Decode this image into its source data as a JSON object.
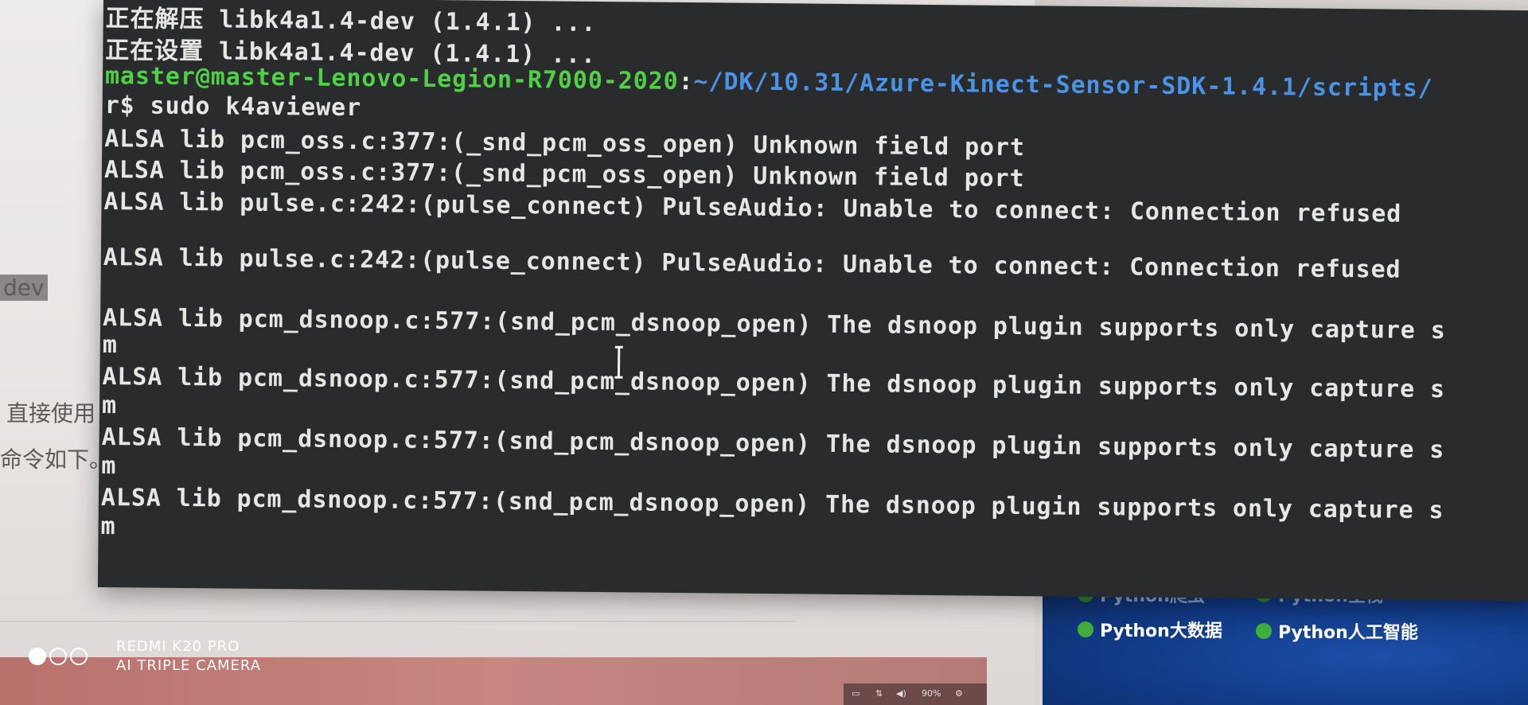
{
  "terminal": {
    "lines": [
      {
        "text": "正在解压 libk4a1.4-dev (1.4.1) ..."
      },
      {
        "text": "正在设置 libk4a1.4-dev (1.4.1) ..."
      },
      {
        "prompt_user": "master@master-Lenovo-Legion-R7000-2020",
        "prompt_sep": ":",
        "prompt_path": "~/DK/10.31/Azure-Kinect-Sensor-SDK-1.4.1/scripts/"
      },
      {
        "text": "r$ sudo k4aviewer"
      },
      {
        "text": "ALSA lib pcm_oss.c:377:(_snd_pcm_oss_open) Unknown field port"
      },
      {
        "text": "ALSA lib pcm_oss.c:377:(_snd_pcm_oss_open) Unknown field port"
      },
      {
        "text": "ALSA lib pulse.c:242:(pulse_connect) PulseAudio: Unable to connect: Connection refused"
      },
      {
        "text": "ALSA lib pulse.c:242:(pulse_connect) PulseAudio: Unable to connect: Connection refused"
      },
      {
        "text": "ALSA lib pcm_dsnoop.c:577:(snd_pcm_dsnoop_open) The dsnoop plugin supports only capture s"
      },
      {
        "text": "m"
      },
      {
        "text": "ALSA lib pcm_dsnoop.c:577:(snd_pcm_dsnoop_open) The dsnoop plugin supports only capture s"
      },
      {
        "text": "m"
      },
      {
        "text": "ALSA lib pcm_dsnoop.c:577:(snd_pcm_dsnoop_open) The dsnoop plugin supports only capture s"
      },
      {
        "text": "m"
      },
      {
        "text": "ALSA lib pcm_dsnoop.c:577:(snd_pcm_dsnoop_open) The dsnoop plugin supports only capture s"
      },
      {
        "text": "m"
      }
    ],
    "cursor_icon": "text-cursor-icon",
    "colors": {
      "background": "#2a2b2c",
      "text": "#e6e6e4",
      "prompt_user": "#4fd046",
      "prompt_path": "#4a93e6"
    }
  },
  "background_page": {
    "fragments": {
      "dev": "dev",
      "direct_use": "直接使用",
      "command": "命令如下。"
    }
  },
  "side_panel": {
    "tags_top": [
      "Python爬虫",
      "Python全栈"
    ],
    "tags": [
      "Python大数据",
      "Python人工智能"
    ],
    "tag_icon": "green-dot-icon"
  },
  "taskbar": {
    "tray_text": "90%"
  },
  "watermark": {
    "line1": "REDMI K20 PRO",
    "line2": "AI TRIPLE CAMERA",
    "icon": "triple-camera-rings-icon"
  }
}
